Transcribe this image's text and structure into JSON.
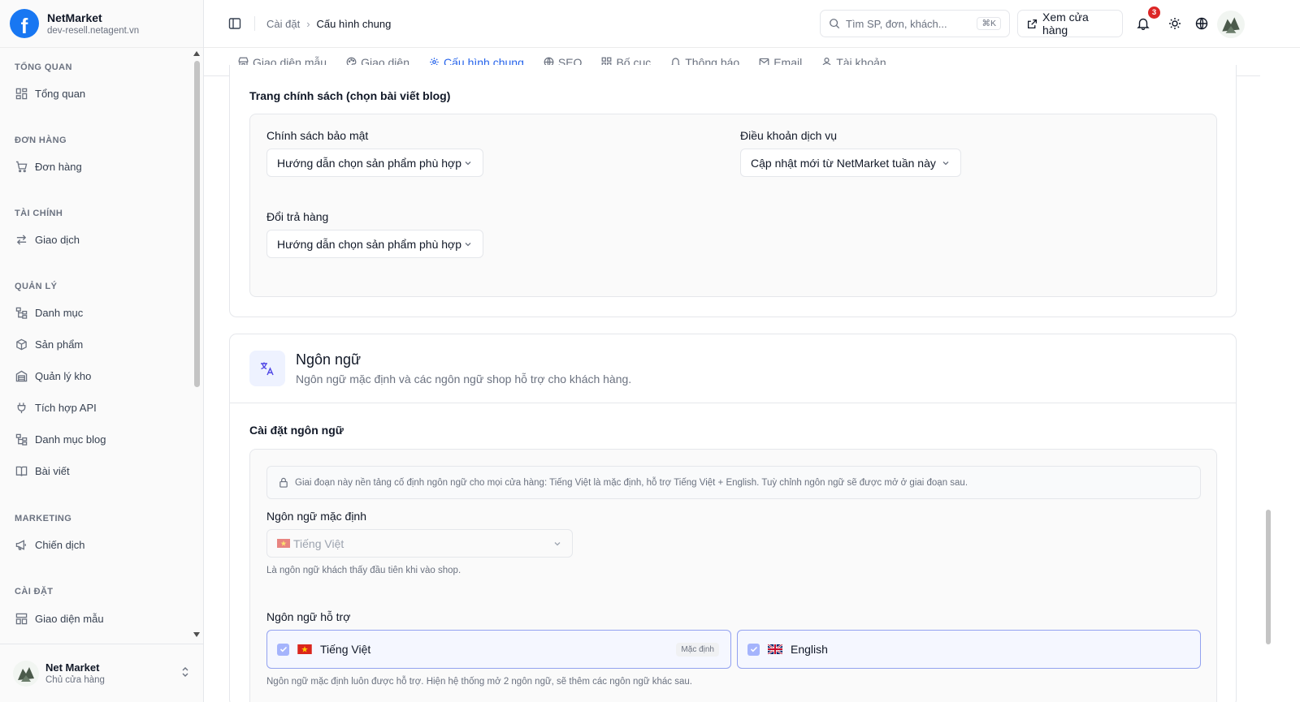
{
  "brand": {
    "name": "NetMarket",
    "domain": "dev-resell.netagent.vn",
    "logo_letter": "f",
    "color": "#1877f2"
  },
  "sidebar": {
    "sections": [
      {
        "title": "TỔNG QUAN",
        "items": [
          {
            "label": "Tổng quan",
            "icon": "dashboard-icon"
          }
        ]
      },
      {
        "title": "ĐƠN HÀNG",
        "items": [
          {
            "label": "Đơn hàng",
            "icon": "cart-icon"
          }
        ]
      },
      {
        "title": "TÀI CHÍNH",
        "items": [
          {
            "label": "Giao dịch",
            "icon": "transfer-icon"
          }
        ]
      },
      {
        "title": "QUẢN LÝ",
        "items": [
          {
            "label": "Danh mục",
            "icon": "tree-icon"
          },
          {
            "label": "Sản phẩm",
            "icon": "box-icon"
          },
          {
            "label": "Quản lý kho",
            "icon": "warehouse-icon"
          },
          {
            "label": "Tích hợp API",
            "icon": "plug-icon"
          },
          {
            "label": "Danh mục blog",
            "icon": "tree-icon"
          },
          {
            "label": "Bài viết",
            "icon": "book-icon"
          }
        ]
      },
      {
        "title": "MARKETING",
        "items": [
          {
            "label": "Chiến dịch",
            "icon": "megaphone-icon"
          }
        ]
      },
      {
        "title": "CÀI ĐẶT",
        "items": [
          {
            "label": "Giao diện mẫu",
            "icon": "layout-icon"
          }
        ]
      }
    ],
    "footer": {
      "name": "Net Market",
      "role": "Chủ cửa hàng"
    }
  },
  "header": {
    "breadcrumb": {
      "parent": "Cài đặt",
      "current": "Cấu hình chung"
    },
    "search": {
      "placeholder": "Tìm SP, đơn, khách...",
      "shortcut": "⌘K"
    },
    "view_store": "Xem cửa hàng",
    "notifications_count": "3"
  },
  "tabs": [
    {
      "label": "Giao diện mẫu",
      "icon": "store-icon"
    },
    {
      "label": "Giao diện",
      "icon": "palette-icon"
    },
    {
      "label": "Cấu hình chung",
      "icon": "gear-icon",
      "active": true
    },
    {
      "label": "SEO",
      "icon": "globe-icon"
    },
    {
      "label": "Bố cục",
      "icon": "grid-icon"
    },
    {
      "label": "Thông báo",
      "icon": "bell-icon"
    },
    {
      "label": "Email",
      "icon": "mail-icon"
    },
    {
      "label": "Tài khoản",
      "icon": "user-icon"
    }
  ],
  "policy": {
    "title": "Trang chính sách (chọn bài viết blog)",
    "privacy_label": "Chính sách bảo mật",
    "privacy_value": "Hướng dẫn chọn sản phẩm phù hợp",
    "terms_label": "Điều khoản dịch vụ",
    "terms_value": "Cập nhật mới từ NetMarket tuần này",
    "return_label": "Đổi trả hàng",
    "return_value": "Hướng dẫn chọn sản phẩm phù hợp"
  },
  "language": {
    "title": "Ngôn ngữ",
    "desc": "Ngôn ngữ mặc định và các ngôn ngữ shop hỗ trợ cho khách hàng.",
    "settings_title": "Cài đặt ngôn ngữ",
    "notice": "Giai đoạn này nền tảng cố định ngôn ngữ cho mọi cửa hàng: Tiếng Việt là mặc định, hỗ trợ Tiếng Việt + English. Tuỳ chỉnh ngôn ngữ sẽ được mở ở giai đoạn sau.",
    "default_label": "Ngôn ngữ mặc định",
    "default_value": "Tiếng Việt",
    "default_helper": "Là ngôn ngữ khách thấy đầu tiên khi vào shop.",
    "supported_label": "Ngôn ngữ hỗ trợ",
    "options": [
      {
        "label": "Tiếng Việt",
        "flag": "vn-flag-icon",
        "badge": "Mặc định",
        "checked": true
      },
      {
        "label": "English",
        "flag": "uk-flag-icon",
        "checked": true
      }
    ],
    "supported_helper": "Ngôn ngữ mặc định luôn được hỗ trợ. Hiện hệ thống mở 2 ngôn ngữ, sẽ thêm các ngôn ngữ khác sau."
  },
  "colors": {
    "accent": "#2563eb",
    "badge": "#dc2626",
    "check": "#a5b4fc"
  }
}
